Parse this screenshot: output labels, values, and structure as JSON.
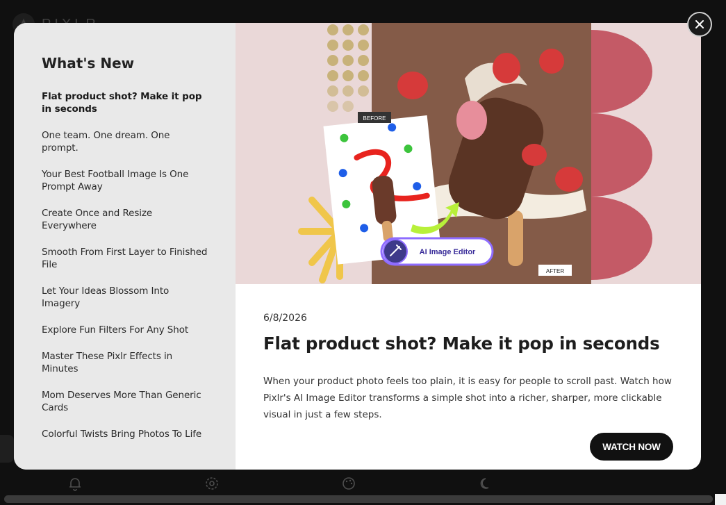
{
  "background": {
    "logo_text": "PIXLR",
    "bottom_icons": [
      "bell-icon",
      "gear-icon",
      "palette-icon",
      "moon-icon"
    ]
  },
  "modal": {
    "sidebar": {
      "title": "What's New",
      "items": [
        {
          "label": "Flat product shot? Make it pop in seconds",
          "active": true
        },
        {
          "label": "One team. One dream. One prompt.",
          "active": false
        },
        {
          "label": "Your Best Football Image Is One Prompt Away",
          "active": false
        },
        {
          "label": "Create Once and Resize Everywhere",
          "active": false
        },
        {
          "label": "Smooth From First Layer to Finished File",
          "active": false
        },
        {
          "label": "Let Your Ideas Blossom Into Imagery",
          "active": false
        },
        {
          "label": "Explore Fun Filters For Any Shot",
          "active": false
        },
        {
          "label": "Master These Pixlr Effects in Minutes",
          "active": false
        },
        {
          "label": "Mom Deserves More Than Generic Cards",
          "active": false
        },
        {
          "label": "Colorful Twists Bring Photos To Life",
          "active": false
        }
      ]
    },
    "hero": {
      "before_label": "BEFORE",
      "after_label": "AFTER",
      "badge_label": "AI Image Editor"
    },
    "article": {
      "date": "6/8/2026",
      "title": "Flat product shot? Make it pop in seconds",
      "body": "When your product photo feels too plain, it is easy for people to scroll past. Watch how Pixlr's AI Image Editor transforms a simple shot into a richer, sharper, more clickable visual in just a few steps.",
      "cta_label": "WATCH NOW"
    }
  },
  "colors": {
    "sidebar_bg": "#e9e9e9",
    "hero_bg": "#ead8d8",
    "cta_bg": "#111111",
    "badge_accent": "#7c4dff"
  }
}
